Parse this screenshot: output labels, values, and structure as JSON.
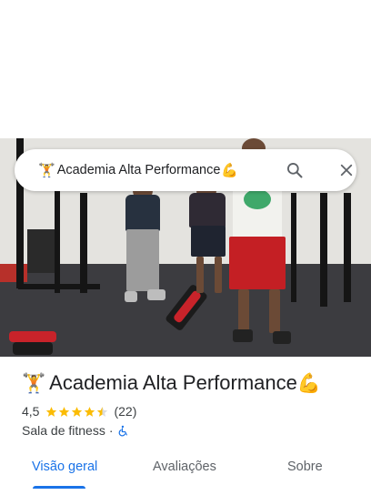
{
  "search": {
    "query": "Academia Alta Performance",
    "emoji_left": "🏋️",
    "emoji_right": "💪",
    "search_icon": "search-icon",
    "close_icon": "close-icon"
  },
  "place": {
    "emoji_left": "🏋️",
    "name": "Academia Alta Performance",
    "emoji_right": "💪",
    "rating": "4,5",
    "rating_value": 4.5,
    "reviews_count": "(22)",
    "category": "Sala de fitness",
    "separator": "·",
    "accessibility_icon": "wheelchair-icon"
  },
  "tabs": [
    {
      "label": "Visão geral",
      "active": true
    },
    {
      "label": "Avaliações",
      "active": false
    },
    {
      "label": "Sobre",
      "active": false
    }
  ],
  "colors": {
    "accent": "#1a73e8",
    "star": "#fbbc04",
    "text_primary": "#202124",
    "text_secondary": "#3c4043"
  }
}
